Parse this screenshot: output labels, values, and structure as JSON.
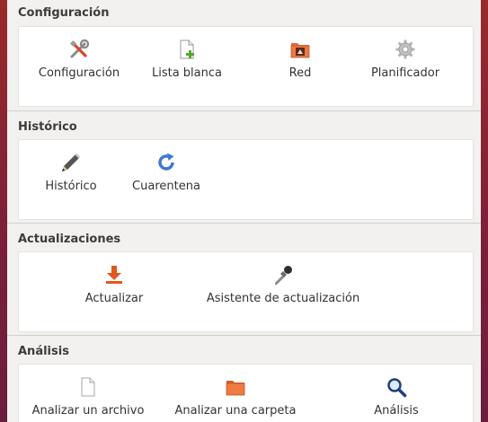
{
  "sections": [
    {
      "title": "Configuración",
      "items": [
        {
          "label": "Configuración",
          "icon": "tools-icon"
        },
        {
          "label": "Lista blanca",
          "icon": "document-add-icon"
        },
        {
          "label": "Red",
          "icon": "network-folder-icon"
        },
        {
          "label": "Planificador",
          "icon": "gear-icon"
        }
      ]
    },
    {
      "title": "Histórico",
      "items": [
        {
          "label": "Histórico",
          "icon": "pencil-icon"
        },
        {
          "label": "Cuarentena",
          "icon": "refresh-icon"
        }
      ]
    },
    {
      "title": "Actualizaciones",
      "items": [
        {
          "label": "Actualizar",
          "icon": "download-icon"
        },
        {
          "label": "Asistente de actualización",
          "icon": "eyedropper-icon"
        }
      ]
    },
    {
      "title": "Análisis",
      "items": [
        {
          "label": "Analizar un archivo",
          "icon": "file-icon"
        },
        {
          "label": "Analizar una carpeta",
          "icon": "folder-icon"
        },
        {
          "label": "Análisis",
          "icon": "magnifier-icon"
        }
      ]
    }
  ],
  "colors": {
    "accent_orange": "#e2561f",
    "icon_blue": "#3b7bd1",
    "panel_bg": "#ffffff",
    "window_bg": "#f2f1f0"
  }
}
